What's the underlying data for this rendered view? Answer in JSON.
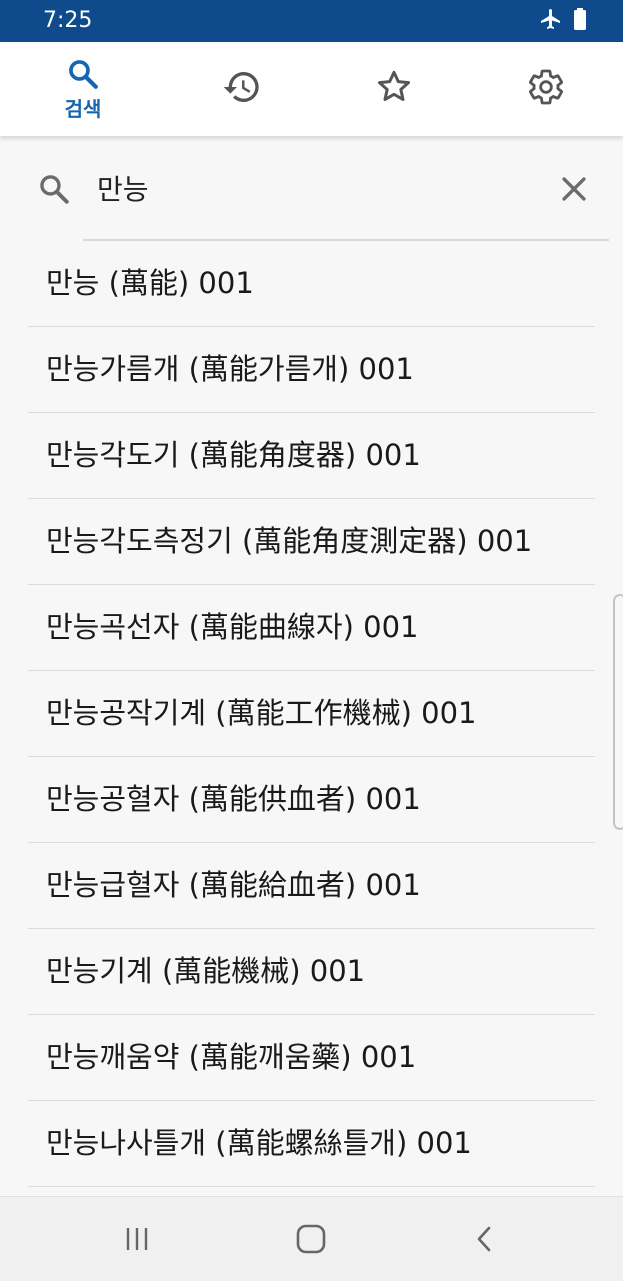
{
  "status_bar": {
    "time": "7:25",
    "icons": [
      "airplane-icon",
      "battery-icon"
    ],
    "background": "#0e4a8c"
  },
  "tabs": [
    {
      "name": "search",
      "label": "검색",
      "icon": "search-icon",
      "active": true
    },
    {
      "name": "history",
      "label": "",
      "icon": "history-icon",
      "active": false
    },
    {
      "name": "favorites",
      "label": "",
      "icon": "star-icon",
      "active": false
    },
    {
      "name": "settings",
      "label": "",
      "icon": "gear-icon",
      "active": false
    }
  ],
  "accent_color": "#1565b0",
  "search": {
    "query": "만능"
  },
  "results": [
    "만능 (萬能) 001",
    "만능가름개 (萬能가름개) 001",
    "만능각도기 (萬能角度器) 001",
    "만능각도측정기 (萬能角度測定器) 001",
    "만능곡선자 (萬能曲線자) 001",
    "만능공작기계 (萬能工作機械) 001",
    "만능공혈자 (萬能供血者) 001",
    "만능급혈자 (萬能給血者) 001",
    "만능기계 (萬能機械) 001",
    "만능깨움약 (萬能깨움藥) 001",
    "만능나사틀개 (萬能螺絲틀개) 001"
  ],
  "nav_bar": {
    "buttons": [
      "recent-apps-icon",
      "home-icon",
      "back-icon"
    ]
  }
}
